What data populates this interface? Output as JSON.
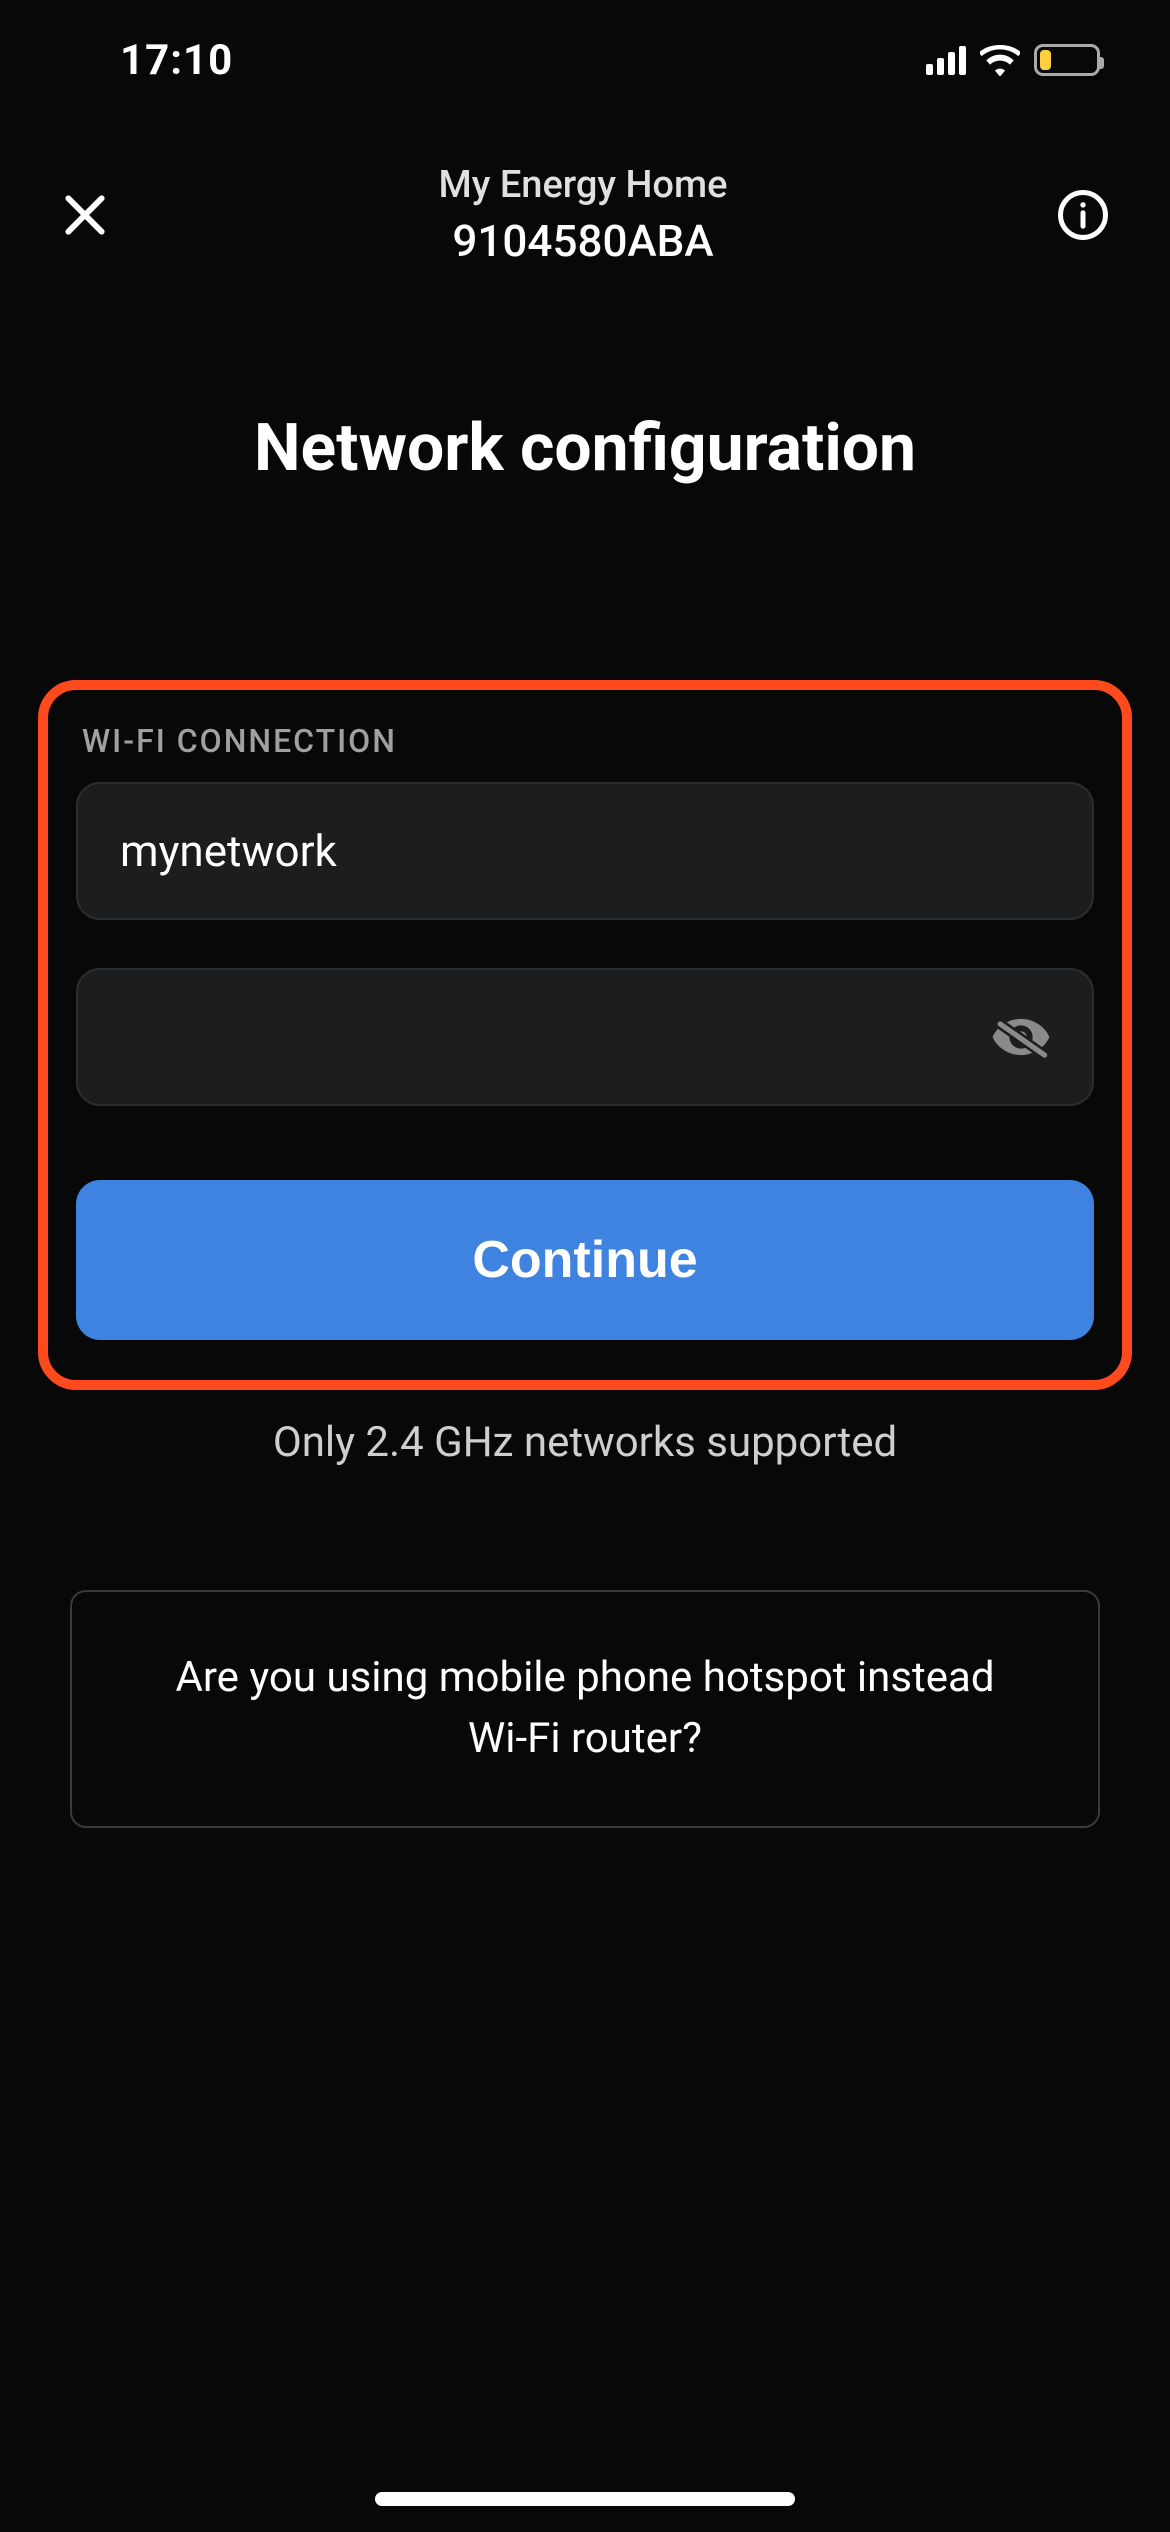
{
  "status": {
    "time": "17:10"
  },
  "header": {
    "title_line1": "My Energy Home",
    "title_line2": "9104580ABA"
  },
  "page": {
    "title": "Network configuration"
  },
  "wifi": {
    "section_label": "WI-FI CONNECTION",
    "ssid_value": "mynetwork",
    "password_value": "",
    "continue_label": "Continue"
  },
  "hint": "Only 2.4 GHz networks supported",
  "hotspot_card": "Are you using mobile phone hotspot instead Wi-Fi router?"
}
